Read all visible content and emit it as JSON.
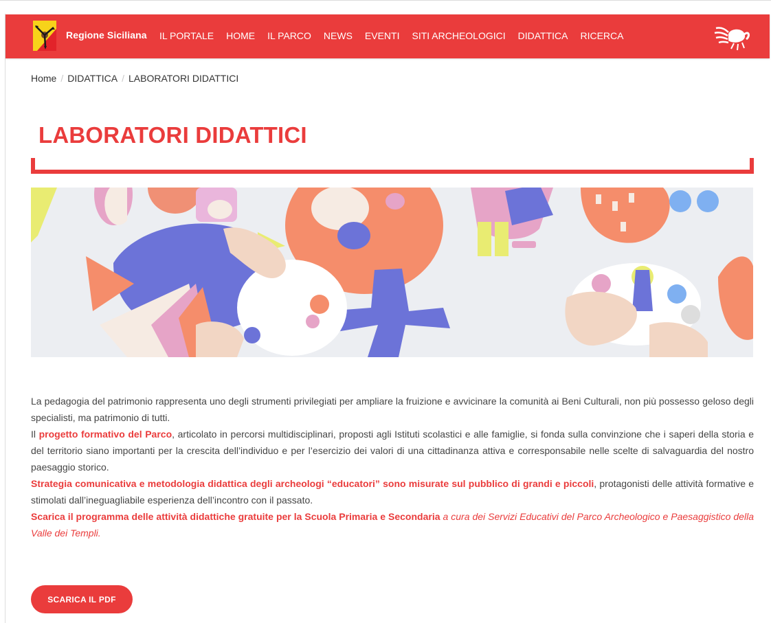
{
  "header": {
    "brand": "Regione Siciliana",
    "nav": [
      "IL PORTALE",
      "HOME",
      "IL PARCO",
      "NEWS",
      "EVENTI",
      "SITI ARCHEOLOGICI",
      "DIDATTICA",
      "RICERCA"
    ],
    "logo_icon": "trinacria-logo-icon",
    "right_icon": "crab-logo-icon",
    "accent": "#ea3c3c"
  },
  "breadcrumb": {
    "home": "Home",
    "section": "DIDATTICA",
    "current": "LABORATORI DIDATTICI",
    "separator": "/"
  },
  "page": {
    "title": "LABORATORI DIDATTICI"
  },
  "content": {
    "p1": "La pedagogia del patrimonio rappresenta uno degli strumenti privilegiati per ampliare la fruizione e avvicinare la comunità ai Beni Culturali, non più possesso geloso degli specialisti, ma patrimonio di tutti.",
    "p2_pre": "Il ",
    "p2_link": "progetto formativo del Parco",
    "p2_post": ", articolato in percorsi multidisciplinari, proposti agli Istituti scolastici e alle famiglie, si fonda sulla convinzione che i saperi della storia e del territorio siano importanti per la crescita dell’individuo e per l’esercizio dei valori di una cittadinanza attiva e corresponsabile nelle scelte di salvaguardia del nostro paesaggio storico.",
    "p3_bold": "Strategia comunicativa e metodologia didattica degli archeologi “educatori” sono misurate sul pubblico di grandi e piccoli",
    "p3_post": ", protagonisti delle attività formative e stimolati dall’ineguagliabile esperienza dell’incontro con il passato.",
    "p4_bold": "Scarica il programma delle attività didattiche gratuite per la Scuola Primaria e Secondaria",
    "p4_italic": " a cura dei Servizi Educativi del Parco Archeologico e Paesaggistico della Valle dei Templi."
  },
  "button": {
    "label": "SCARICA IL PDF"
  }
}
